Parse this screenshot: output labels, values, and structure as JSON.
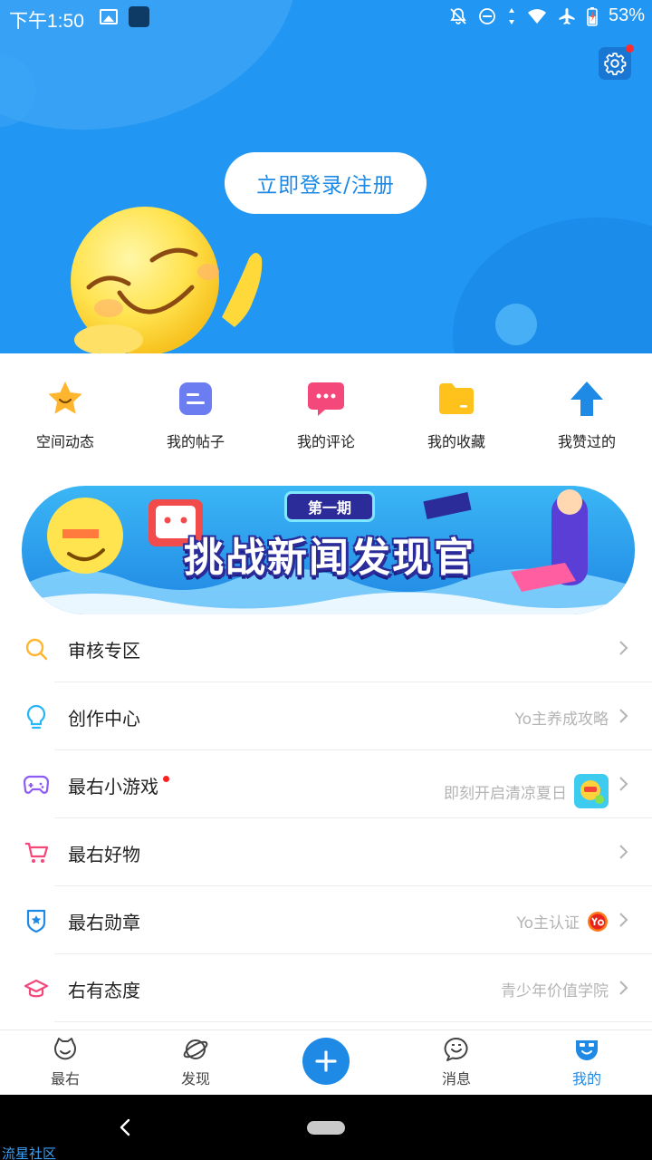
{
  "status": {
    "time": "下午1:50",
    "battery": "53%"
  },
  "header": {
    "login_label": "立即登录/注册"
  },
  "quick_actions": [
    {
      "label": "空间动态",
      "icon": "star-face-icon",
      "color": "#FFB62E"
    },
    {
      "label": "我的帖子",
      "icon": "post-icon",
      "color": "#6C7DF2"
    },
    {
      "label": "我的评论",
      "icon": "comment-icon",
      "color": "#F4487A"
    },
    {
      "label": "我的收藏",
      "icon": "folder-icon",
      "color": "#FFC21C"
    },
    {
      "label": "我赞过的",
      "icon": "thumb-up-arrow-icon",
      "color": "#1E8AE6"
    }
  ],
  "banner": {
    "issue": "第一期",
    "title": "挑战新闻发现官"
  },
  "menu": [
    {
      "label": "审核专区",
      "hint": "",
      "icon": "search-icon",
      "color": "#FFB62E"
    },
    {
      "label": "创作中心",
      "hint": "Yo主养成攻略",
      "icon": "bulb-icon",
      "color": "#29B6F6"
    },
    {
      "label": "最右小游戏",
      "hint": "即刻开启清凉夏日",
      "icon": "gamepad-icon",
      "color": "#8E5CF2"
    },
    {
      "label": "最右好物",
      "hint": "",
      "icon": "cart-icon",
      "color": "#F4487A"
    },
    {
      "label": "最右勋章",
      "hint": "Yo主认证",
      "icon": "badge-icon",
      "color": "#1E8AE6"
    },
    {
      "label": "右有态度",
      "hint": "青少年价值学院",
      "icon": "graduation-cap-icon",
      "color": "#F4487A"
    }
  ],
  "nav": [
    {
      "label": "最右",
      "active": false
    },
    {
      "label": "发现",
      "active": false
    },
    {
      "label": "消息",
      "active": false
    },
    {
      "label": "我的",
      "active": true
    }
  ],
  "watermark": "流星社区",
  "colors": {
    "brand_blue": "#2196F3",
    "accent_blue": "#1E8AE6"
  }
}
